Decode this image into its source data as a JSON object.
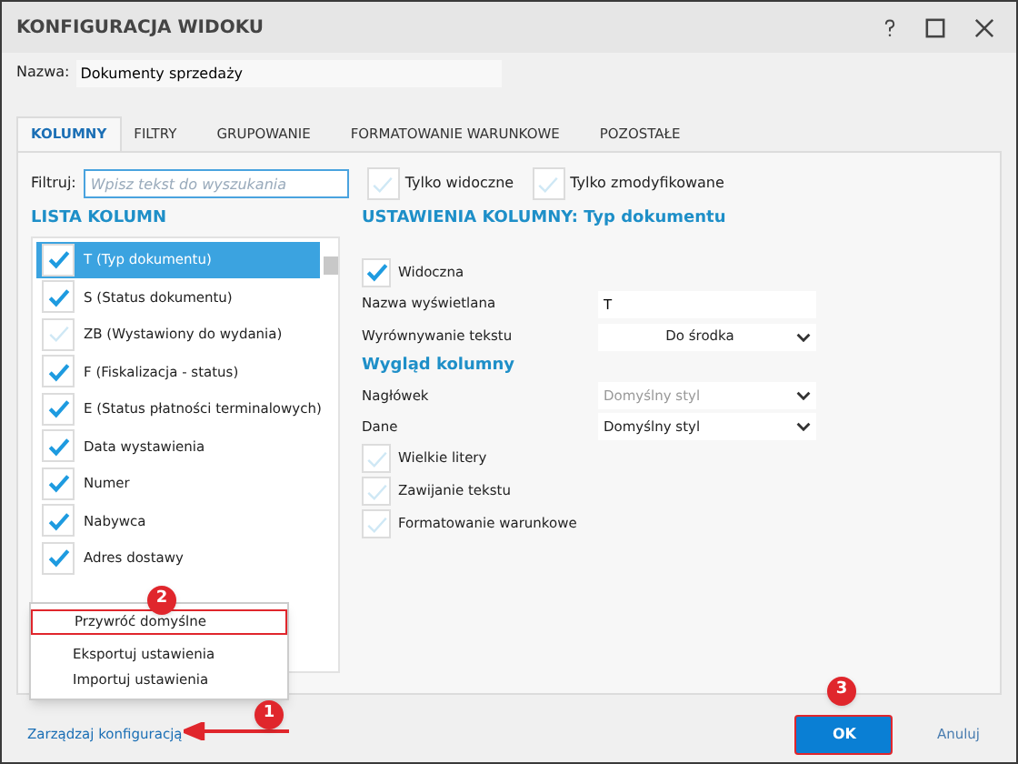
{
  "window": {
    "title": "KONFIGURACJA WIDOKU"
  },
  "name_field": {
    "label": "Nazwa:",
    "value": "Dokumenty sprzedaży"
  },
  "tabs": [
    {
      "label": "KOLUMNY",
      "selected": true
    },
    {
      "label": "FILTRY",
      "selected": false
    },
    {
      "label": "GRUPOWANIE",
      "selected": false
    },
    {
      "label": "FORMATOWANIE WARUNKOWE",
      "selected": false
    },
    {
      "label": "POZOSTAŁE",
      "selected": false
    }
  ],
  "filter": {
    "label": "Filtruj:",
    "placeholder": "Wpisz tekst do wyszukania"
  },
  "filter_options": [
    {
      "label": "Tylko widoczne",
      "checked": false
    },
    {
      "label": "Tylko zmodyfikowane",
      "checked": false
    }
  ],
  "column_list": {
    "title": "LISTA KOLUMN",
    "items": [
      {
        "label": "T (Typ dokumentu)",
        "checked": true,
        "selected": true
      },
      {
        "label": "S (Status dokumentu)",
        "checked": true,
        "selected": false
      },
      {
        "label": "ZB (Wystawiony do wydania)",
        "checked": false,
        "selected": false
      },
      {
        "label": "F (Fiskalizacja - status)",
        "checked": true,
        "selected": false
      },
      {
        "label": "E (Status płatności terminalowych)",
        "checked": true,
        "selected": false
      },
      {
        "label": "Data wystawienia",
        "checked": true,
        "selected": false
      },
      {
        "label": "Numer",
        "checked": true,
        "selected": false
      },
      {
        "label": "Nabywca",
        "checked": true,
        "selected": false
      },
      {
        "label": "Adres dostawy",
        "checked": true,
        "selected": false
      }
    ]
  },
  "column_settings": {
    "title": "USTAWIENIA KOLUMNY: Typ dokumentu",
    "visible": {
      "label": "Widoczna",
      "checked": true
    },
    "display_name": {
      "label": "Nazwa wyświetlana",
      "value": "T"
    },
    "alignment": {
      "label": "Wyrównywanie tekstu",
      "value": "Do środka"
    },
    "appearance_title": "Wygląd kolumny",
    "header_style": {
      "label": "Nagłówek",
      "value": "Domyślny styl",
      "disabled": true
    },
    "data_style": {
      "label": "Dane",
      "value": "Domyślny styl",
      "disabled": false
    },
    "options": [
      {
        "label": "Wielkie litery",
        "checked": false
      },
      {
        "label": "Zawijanie tekstu",
        "checked": false
      },
      {
        "label": "Formatowanie warunkowe",
        "checked": false
      }
    ]
  },
  "config_menu": {
    "items": [
      {
        "label": "Przywróć domyślne",
        "highlighted": true
      },
      {
        "label": "Eksportuj ustawienia",
        "highlighted": false
      },
      {
        "label": "Importuj ustawienia",
        "highlighted": false
      }
    ]
  },
  "footer": {
    "manage_link": "Zarządzaj konfiguracją",
    "ok": "OK",
    "cancel": "Anuluj"
  },
  "annotations": [
    "1",
    "2",
    "3"
  ]
}
